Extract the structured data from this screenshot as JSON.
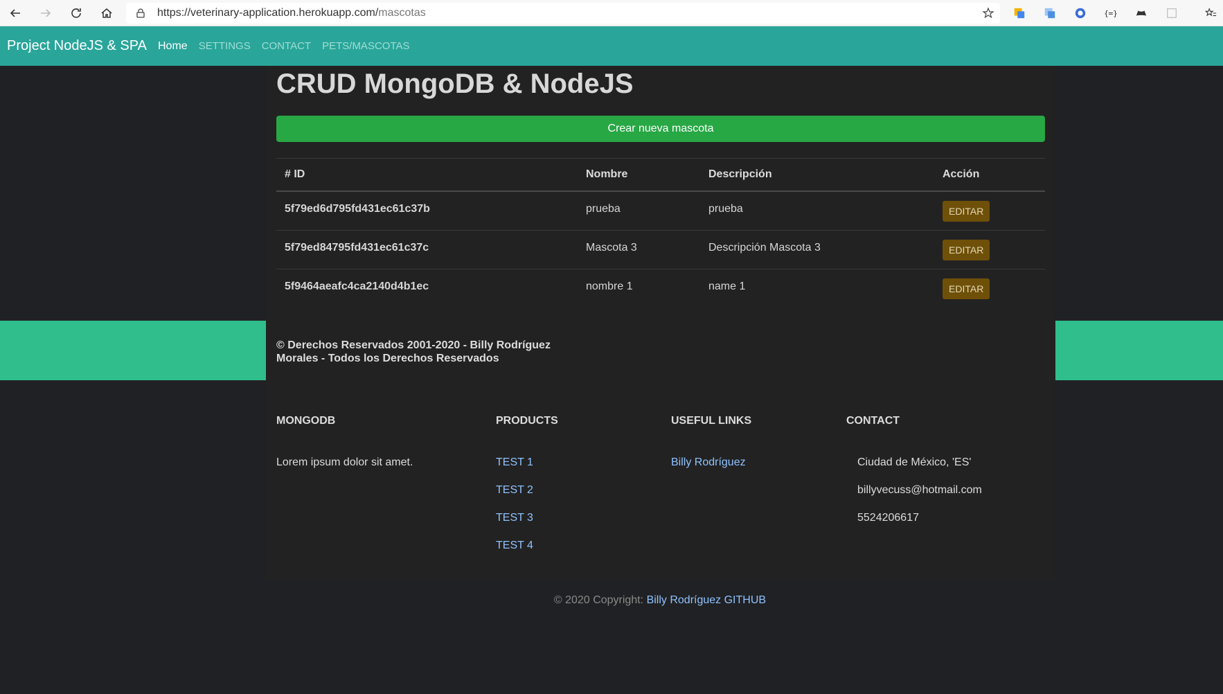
{
  "browser": {
    "url_host": "https://veterinary-application.herokuapp.com/",
    "url_path": "mascotas"
  },
  "navbar": {
    "brand": "Project NodeJS & SPA",
    "links": [
      "Home",
      "SETTINGS",
      "CONTACT",
      "PETS/MASCOTAS"
    ]
  },
  "main": {
    "title": "CRUD MongoDB & NodeJS",
    "create_button": "Crear nueva mascota",
    "table": {
      "headers": [
        "# ID",
        "Nombre",
        "Descripción",
        "Acción"
      ],
      "rows": [
        {
          "id": "5f79ed6d795fd431ec61c37b",
          "nombre": "prueba",
          "descripcion": "prueba",
          "accion": "EDITAR"
        },
        {
          "id": "5f79ed84795fd431ec61c37c",
          "nombre": "Mascota 3",
          "descripcion": "Descripción Mascota 3",
          "accion": "EDITAR"
        },
        {
          "id": "5f9464aeafc4ca2140d4b1ec",
          "nombre": "nombre 1",
          "descripcion": "name 1",
          "accion": "EDITAR"
        }
      ]
    }
  },
  "copyright_band": {
    "text": "© Derechos Reservados 2001-2020 - Billy Rodríguez Morales - Todos los Derechos Reservados"
  },
  "footer": {
    "mongodb": {
      "heading": "MONGODB",
      "text": "Lorem ipsum dolor sit amet."
    },
    "products": {
      "heading": "PRODUCTS",
      "items": [
        "TEST 1",
        "TEST 2",
        "TEST 3",
        "TEST 4"
      ]
    },
    "useful_links": {
      "heading": "USEFUL LINKS",
      "items": [
        "Billy Rodríguez"
      ]
    },
    "contact": {
      "heading": "CONTACT",
      "items": [
        "Ciudad de México, 'ES'",
        "billyvecuss@hotmail.com",
        "5524206617"
      ]
    }
  },
  "bottom": {
    "prefix": "© 2020 Copyright: ",
    "link": "Billy Rodríguez GITHUB"
  },
  "colors": {
    "navbar": "#2aa59a",
    "green_band": "#2fbe8c",
    "create_button": "#28a745",
    "edit_button": "#6e5009",
    "link": "#8fc2ff"
  }
}
